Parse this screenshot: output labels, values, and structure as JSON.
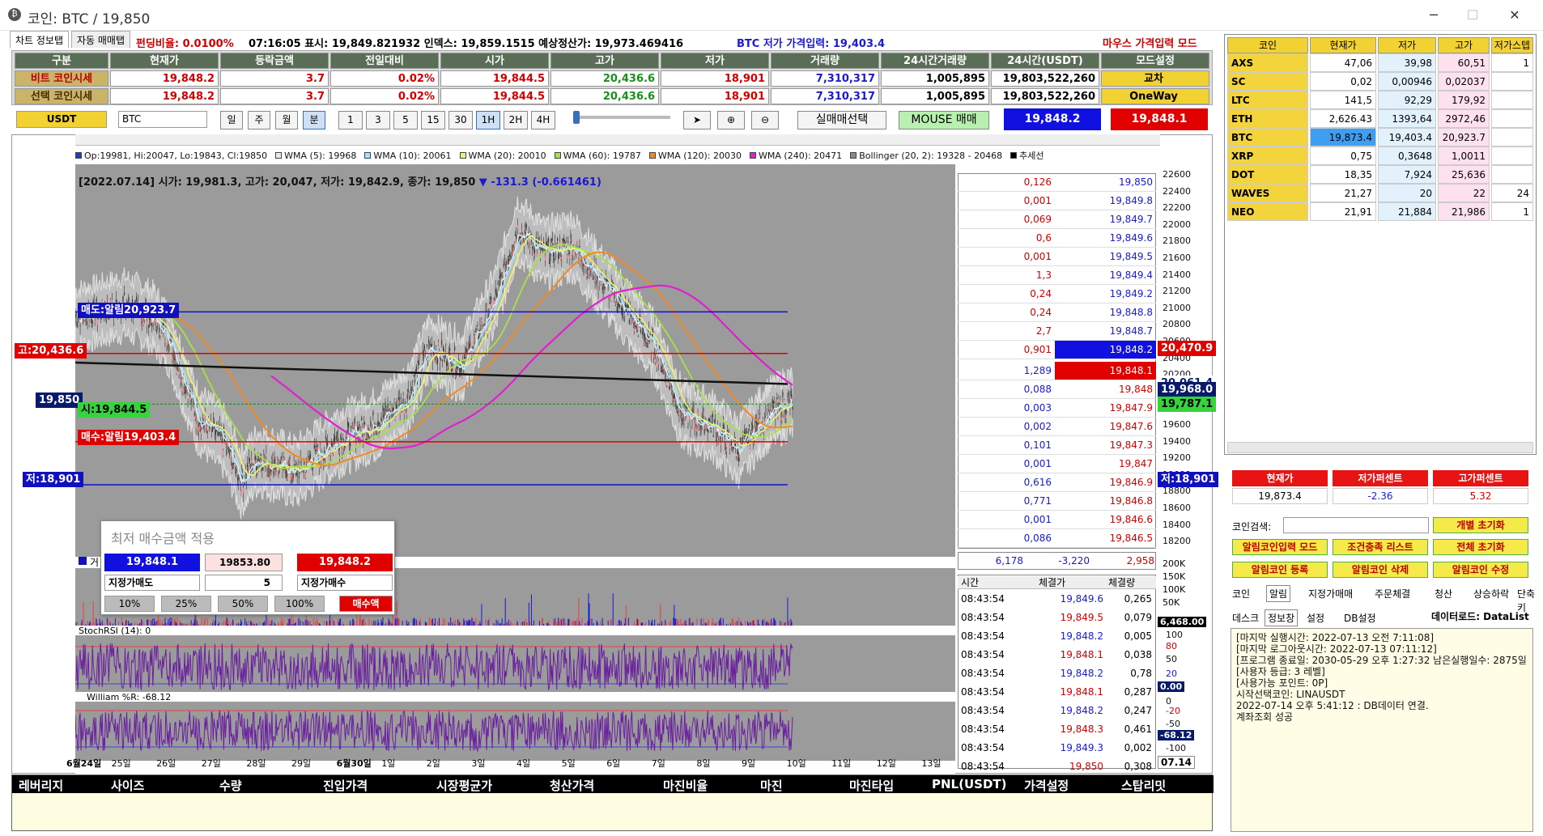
{
  "window": {
    "title": "코인: BTC / 19,850",
    "min": "─",
    "max": "☐",
    "close": "✕"
  },
  "tabs": {
    "chart_info": "차트 정보탭",
    "auto_trade": "자동 매매탭"
  },
  "infoline": {
    "funding": "펀딩비율: 0.0100%",
    "time_line": "07:16:05 표시: 19,849.821932 인덱스: 19,859.1515 예상정산가: 19,973.469416",
    "low_input": "BTC 저가 가격입력: 19,403.4",
    "mode": "마우스 가격입력 모드"
  },
  "grid": {
    "headers": [
      "구분",
      "현재가",
      "등락금액",
      "전일대비",
      "시가",
      "고가",
      "저가",
      "거래량",
      "24시간거래량",
      "24시간(USDT)",
      "모드설정"
    ],
    "rows": [
      {
        "label": "비트 코인시세",
        "values": [
          "19,848.2",
          "3.7",
          "0.02%",
          "19,844.5",
          "20,436.6",
          "18,901",
          "7,310,317",
          "1,005,895",
          "19,803,522,260",
          "교차"
        ]
      },
      {
        "label": "선택 코인시세",
        "values": [
          "19,848.2",
          "3.7",
          "0.02%",
          "19,844.5",
          "20,436.6",
          "18,901",
          "7,310,317",
          "1,005,895",
          "19,803,522,260",
          "OneWay"
        ]
      }
    ]
  },
  "controls": {
    "usdt": "USDT",
    "symbol": "BTC",
    "periods": [
      "일",
      "주",
      "월",
      "분"
    ],
    "minutes": [
      "1",
      "3",
      "5",
      "15",
      "30",
      "1H",
      "2H",
      "4H"
    ],
    "select_trade": "실매매선택",
    "mouse_trade": "MOUSE 매매",
    "bid_price": "19,848.2",
    "ask_price": "19,848.1"
  },
  "chart": {
    "legend": [
      {
        "label": "Op:19981, Hi:20047, Lo:19843, Cl:19850",
        "color": "#1a3fbf"
      },
      {
        "label": "WMA (5): 19968",
        "color": "#e8e8e8"
      },
      {
        "label": "WMA (10): 20061",
        "color": "#9be7ff"
      },
      {
        "label": "WMA (20): 20010",
        "color": "#f4f06a"
      },
      {
        "label": "WMA (60): 19787",
        "color": "#a8e04a"
      },
      {
        "label": "WMA (120): 20030",
        "color": "#f08a24"
      },
      {
        "label": "WMA (240): 20471",
        "color": "#e020d0"
      },
      {
        "label": "Bollinger (20, 2): 19328 - 20468",
        "color": "#888888"
      },
      {
        "label": "추세선",
        "color": "#000000"
      }
    ],
    "ohlc_line": "[2022.07.14]  시가: 19,981.3, 고가: 20,047, 저가: 19,842.9, 종가: 19,850",
    "change": "▼ -131.3 (-0.661461)",
    "tags": {
      "sell_alarm": "매도:알림20,923.7",
      "high": "고:20,436.6",
      "current_left": "19,850",
      "open": "시:19,844.5",
      "buy_alarm": "매수:알림19,403.4",
      "low": "저:18,901",
      "right_high": "20,470.9",
      "right_mid1": "20,061.4",
      "right_mid2": "19,968.0",
      "right_mid3": "19,787.1",
      "right_low": "저:18,901"
    },
    "y_ticks": [
      "22600",
      "22400",
      "22200",
      "22000",
      "21800",
      "21600",
      "21400",
      "21200",
      "21000",
      "20800",
      "20600",
      "20400",
      "20200",
      "20000",
      "19800",
      "19600",
      "19400",
      "19200",
      "19000",
      "18800",
      "18600",
      "18400",
      "18200"
    ],
    "vol_ticks": [
      "200K",
      "150K",
      "100K",
      "50K"
    ],
    "vol_label": "6,468.00",
    "rsi_ticks": [
      "100",
      "80",
      "50",
      "20",
      "0"
    ],
    "rsi_value": "0.00",
    "wr_ticks": [
      "0",
      "-20",
      "-50",
      "-80",
      "-100"
    ],
    "wr_value": "-68.12",
    "date_end": "07.14",
    "x_dates": [
      "6월24일",
      "25일",
      "26일",
      "27일",
      "28일",
      "29일",
      "6월30일",
      "1일",
      "2일",
      "3일",
      "4일",
      "5일",
      "6일",
      "7일",
      "8일",
      "9일",
      "10일",
      "11일",
      "12일",
      "13일"
    ],
    "vol_panel_label": "거",
    "stoch_label": "StochRSI (14): 0",
    "william_label": "William %R: -68.12"
  },
  "orderbook": {
    "asks": [
      {
        "q": "0,126",
        "p": "19,850"
      },
      {
        "q": "0,001",
        "p": "19,849.8"
      },
      {
        "q": "0,069",
        "p": "19,849.7"
      },
      {
        "q": "0,6",
        "p": "19,849.6"
      },
      {
        "q": "0,001",
        "p": "19,849.5"
      },
      {
        "q": "1,3",
        "p": "19,849.4"
      },
      {
        "q": "0,24",
        "p": "19,849.2"
      },
      {
        "q": "0,24",
        "p": "19,848.8"
      },
      {
        "q": "2,7",
        "p": "19,848.7"
      },
      {
        "q": "0,901",
        "p": "19,848.2"
      }
    ],
    "bids": [
      {
        "q": "1,289",
        "p": "19,848.1"
      },
      {
        "q": "0,088",
        "p": "19,848"
      },
      {
        "q": "0,003",
        "p": "19,847.9"
      },
      {
        "q": "0,002",
        "p": "19,847.6"
      },
      {
        "q": "0,101",
        "p": "19,847.3"
      },
      {
        "q": "0,001",
        "p": "19,847"
      },
      {
        "q": "0,616",
        "p": "19,846.9"
      },
      {
        "q": "0,771",
        "p": "19,846.8"
      },
      {
        "q": "0,001",
        "p": "19,846.6"
      },
      {
        "q": "0,086",
        "p": "19,846.5"
      }
    ],
    "footer": [
      "6,178",
      "-3,220",
      "2,958"
    ]
  },
  "trades": {
    "headers": [
      "시간",
      "체결가",
      "체결량"
    ],
    "rows": [
      [
        "08:43:54",
        "19,849.6",
        "0,265"
      ],
      [
        "08:43:54",
        "19,849.5",
        "0,079"
      ],
      [
        "08:43:54",
        "19,848.2",
        "0,005"
      ],
      [
        "08:43:54",
        "19,848.1",
        "0,038"
      ],
      [
        "08:43:54",
        "19,848.2",
        "0,78"
      ],
      [
        "08:43:54",
        "19,848.1",
        "0,287"
      ],
      [
        "08:43:54",
        "19,848.2",
        "0,247"
      ],
      [
        "08:43:54",
        "19,848.3",
        "0,461"
      ],
      [
        "08:43:54",
        "19,849.3",
        "0,002"
      ],
      [
        "08:43:54",
        "19,850",
        "0,308"
      ]
    ]
  },
  "popup": {
    "title": "최저 매수금액 적용",
    "left_price": "19,848.1",
    "mid_value": "19853.80",
    "right_price": "19,848.2",
    "sell_type": "지정가매도",
    "qty": "5",
    "buy_type": "지정가매수",
    "pcts": [
      "10%",
      "25%",
      "50%",
      "100%"
    ],
    "buy_btn": "매수액"
  },
  "bottom": {
    "headers": [
      "레버리지",
      "사이즈",
      "수량",
      "진입가격",
      "시장평균가",
      "청산가격",
      "마진비율",
      "마진",
      "마진타입",
      "PNL(USDT)",
      "가격설정",
      "스탑리밋"
    ]
  },
  "right": {
    "coin_headers": [
      "코인",
      "현재가",
      "저가",
      "고가",
      "저가스텝"
    ],
    "coins": [
      [
        "AXS",
        "47,06",
        "39,98",
        "60,51",
        "1"
      ],
      [
        "SC",
        "0,02",
        "0,00946",
        "0,02037",
        ""
      ],
      [
        "LTC",
        "141,5",
        "92,29",
        "179,92",
        ""
      ],
      [
        "ETH",
        "2,626.43",
        "1393,64",
        "2972,46",
        ""
      ],
      [
        "BTC",
        "19,873.4",
        "19,403.4",
        "20,923.7",
        ""
      ],
      [
        "XRP",
        "0,75",
        "0,3648",
        "1,0011",
        ""
      ],
      [
        "DOT",
        "18,35",
        "7,924",
        "25,636",
        ""
      ],
      [
        "WAVES",
        "21,27",
        "20",
        "22",
        "24"
      ],
      [
        "NEO",
        "21,91",
        "21,884",
        "21,986",
        "1"
      ]
    ],
    "pct_headers": [
      "현재가",
      "저가퍼센트",
      "고가퍼센트"
    ],
    "pct_values": [
      "19,873.4",
      "-2.36",
      "5.32"
    ],
    "search_label": "코인검색:",
    "btns": [
      "개별 초기화",
      "알림코인입력 모드",
      "조건충족 리스트",
      "전체 초기화",
      "알림코인 등록",
      "알림코인 삭제",
      "알림코인 수정"
    ],
    "tabs1": [
      "코인",
      "알림",
      "지정가매매",
      "주문체결",
      "청산",
      "상승하락",
      "단축키"
    ],
    "tabs2": [
      "데스크",
      "정보창",
      "설정",
      "DB설정"
    ],
    "dataload": "데이터로드: DataList",
    "log": [
      "[마지막 실행시간: 2022-07-13 오전 7:11:08]",
      "[마지막 로그아웃시간: 2022-07-13 07:11:12]",
      "[프로그램 종료일: 2030-05-29 오후 1:27:32 남은실행일수: 2875일]",
      "[사용자 등급: 3 레벨]",
      "[사용가능 포인트: 0P]",
      "시작선택코인: LINAUSDT",
      "2022-07-14 오후 5:41:12 : DB데이터 연결.",
      "계좌조회 성공"
    ]
  }
}
